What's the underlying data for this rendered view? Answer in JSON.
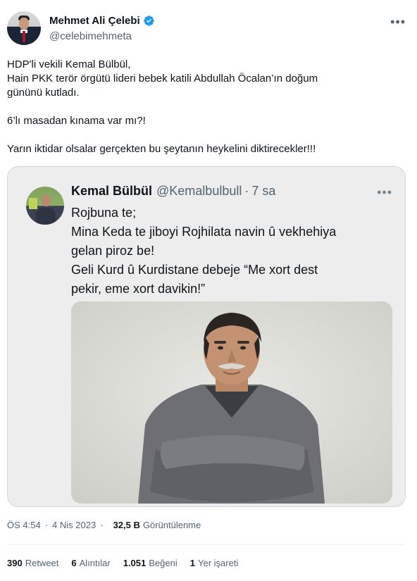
{
  "author": {
    "name": "Mehmet Ali Çelebi",
    "handle": "@celebimehmeta",
    "verified_color": "#1d9bf0"
  },
  "tweet": {
    "lines": [
      "HDP'li vekili Kemal Bülbül,",
      "Hain PKK terör örgütü lideri bebek katili Abdullah Öcalan’ın doğum",
      "gününü kutladı.",
      "6’lı masadan kınama var mı?!",
      "Yarın iktidar olsalar gerçekten bu şeytanın heykelini diktirecekler!!!"
    ]
  },
  "quoted_tweet": {
    "name": "Kemal Bülbül",
    "handle": "@Kemalbulbull",
    "separator": "·",
    "time": "7 sa",
    "lines": [
      "Rojbuna te;",
      "Mina Keda te jiboyi Rojhilata navin û vekhehiya",
      "gelan piroz be!",
      "Geli Kurd û Kurdistane debeje “Me xort dest",
      "pekir, eme xort davikin!”"
    ]
  },
  "meta": {
    "time": "ÖS 4:54",
    "separator": "·",
    "date": "4 Nis 2023",
    "views_count": "32,5 B",
    "views_label": "Görüntülenme"
  },
  "stats": {
    "retweets_count": "390",
    "retweets_label": "Retweet",
    "quotes_count": "6",
    "quotes_label": "Alıntılar",
    "likes_count": "1.051",
    "likes_label": "Beğeni",
    "bookmarks_count": "1",
    "bookmarks_label": "Yer işareti"
  },
  "icons": {
    "more": "more-horizontal-icon",
    "verified": "verified-badge-icon"
  }
}
